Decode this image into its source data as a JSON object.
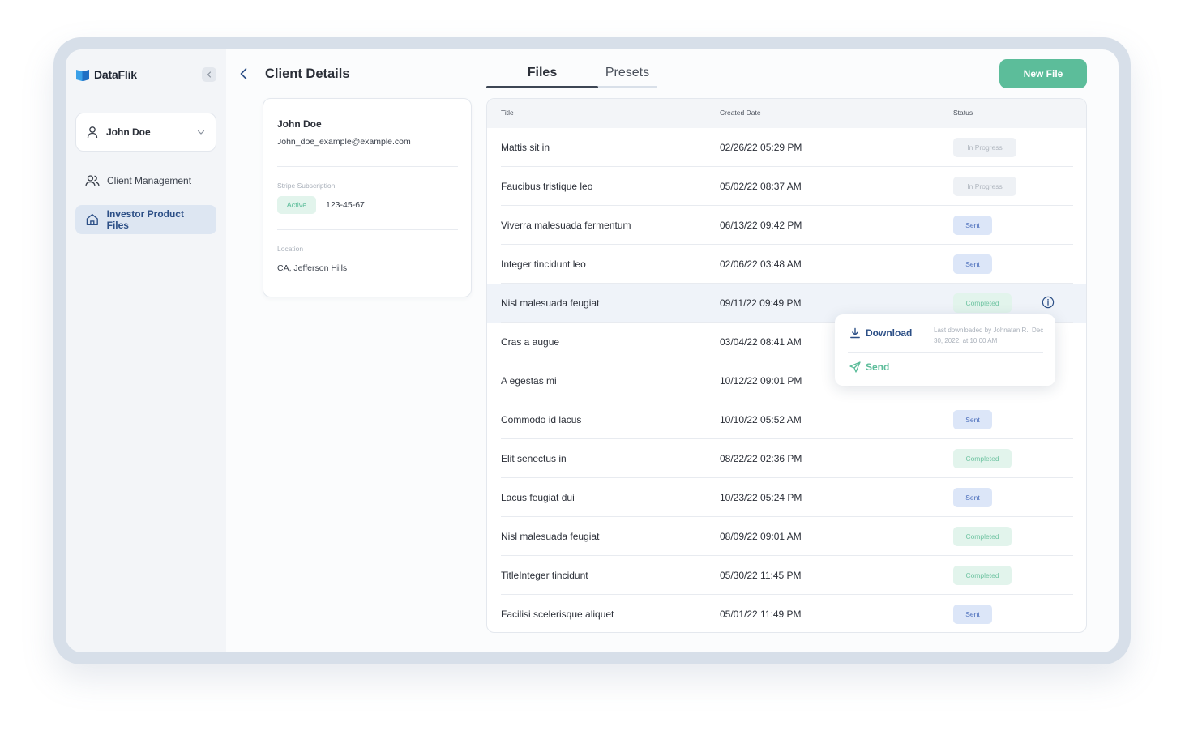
{
  "app": {
    "name": "DataFlik",
    "colors": {
      "accent": "#5cbd9a",
      "nav_active": "#2c4f86",
      "sent": "#4a6dbb"
    }
  },
  "sidebar": {
    "user": "John Doe",
    "items": [
      {
        "label": "Client Management",
        "icon": "users-icon",
        "active": false
      },
      {
        "label": "Investor Product Files",
        "icon": "home-icon",
        "active": true
      }
    ]
  },
  "header": {
    "title": "Client Details",
    "tabs": [
      {
        "label": "Files",
        "active": true
      },
      {
        "label": "Presets",
        "active": false
      }
    ],
    "new_file_label": "New File"
  },
  "client": {
    "name": "John Doe",
    "email": "John_doe_example@example.com",
    "subscription_label": "Stripe Subscription",
    "subscription_status": "Active",
    "subscription_id": "123-45-67",
    "location_label": "Location",
    "location": "CA, Jefferson Hills"
  },
  "table": {
    "columns": [
      "Title",
      "Created Date",
      "Status"
    ],
    "rows": [
      {
        "title": "Mattis sit in",
        "date": "02/26/22 05:29 PM",
        "status": "In Progress",
        "kind": "progress"
      },
      {
        "title": "Faucibus tristique leo",
        "date": "05/02/22 08:37 AM",
        "status": "In Progress",
        "kind": "progress"
      },
      {
        "title": "Viverra malesuada fermentum",
        "date": "06/13/22 09:42 PM",
        "status": "Sent",
        "kind": "sent"
      },
      {
        "title": "Integer tincidunt leo",
        "date": "02/06/22 03:48 AM",
        "status": "Sent",
        "kind": "sent"
      },
      {
        "title": "Nisl malesuada feugiat",
        "date": "09/11/22 09:49 PM",
        "status": "Completed",
        "kind": "completed"
      },
      {
        "title": "Cras a augue",
        "date": "03/04/22 08:41 AM",
        "status": "",
        "kind": "none"
      },
      {
        "title": "A egestas mi",
        "date": "10/12/22 09:01 PM",
        "status": "",
        "kind": "none"
      },
      {
        "title": "Commodo id lacus",
        "date": "10/10/22 05:52 AM",
        "status": "Sent",
        "kind": "sent"
      },
      {
        "title": "Elit senectus in",
        "date": "08/22/22 02:36 PM",
        "status": "Completed",
        "kind": "completed"
      },
      {
        "title": "Lacus feugiat dui",
        "date": "10/23/22 05:24 PM",
        "status": "Sent",
        "kind": "sent"
      },
      {
        "title": "Nisl malesuada feugiat",
        "date": "08/09/22 09:01 AM",
        "status": "Completed",
        "kind": "completed"
      },
      {
        "title": "TitleInteger tincidunt",
        "date": "05/30/22 11:45 PM",
        "status": "Completed",
        "kind": "completed"
      },
      {
        "title": "Facilisi scelerisque aliquet",
        "date": "05/01/22 11:49 PM",
        "status": "Sent",
        "kind": "sent"
      }
    ]
  },
  "popup": {
    "download_label": "Download",
    "send_label": "Send",
    "note": "Last downloaded by Johnatan R., Dec 30, 2022, at 10:00 AM"
  }
}
